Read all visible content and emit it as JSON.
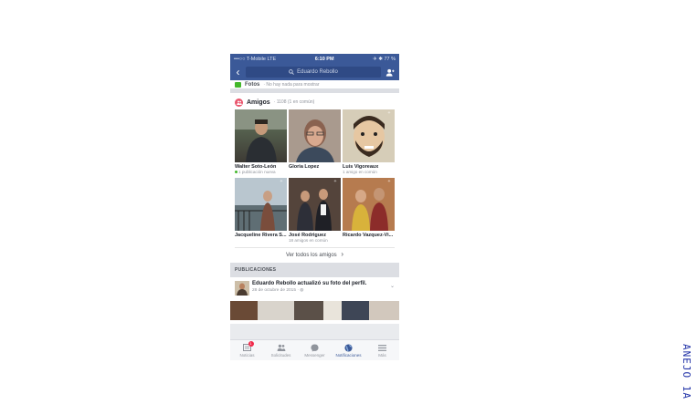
{
  "status_bar": {
    "carrier": "•••○○ T-Mobile  LTE",
    "time": "6:10 PM",
    "battery": "✈ ✱ 77 %"
  },
  "nav": {
    "search_text": "Eduardo Rebollo",
    "back_icon": "chevron-left-icon",
    "friend_icon": "friend-request-icon"
  },
  "fotos": {
    "title": "Fotos",
    "subtitle": "· No hay nada para mostrar"
  },
  "friends": {
    "title": "Amigos",
    "count": "· 1108 (1 en común)",
    "items": [
      {
        "name": "Walter Soto-León",
        "sub": "1 publicación nueva",
        "new_dot": true,
        "add_icon": false
      },
      {
        "name": "Gloria Lopez",
        "sub": "",
        "new_dot": false,
        "add_icon": false
      },
      {
        "name": "Luis Vigoreaux",
        "sub": "1 amigo en común",
        "new_dot": false,
        "add_icon": true
      },
      {
        "name": "Jacqueline Rivera S...",
        "sub": "",
        "new_dot": false,
        "add_icon": true
      },
      {
        "name": "José Rodriguez",
        "sub": "18 amigos en común",
        "new_dot": false,
        "add_icon": true
      },
      {
        "name": "Ricardo Vazquez-Vi...",
        "sub": "",
        "new_dot": false,
        "add_icon": true
      }
    ],
    "see_all": "Ver todos los amigos"
  },
  "publications": {
    "header": "PUBLICACIONES",
    "post_text": "Eduardo Rebollo actualizó su foto del perfil.",
    "post_date": "28 de octubre de 2015 · ◍"
  },
  "tabbar": {
    "tabs": [
      {
        "label": "Noticias",
        "badge": "1"
      },
      {
        "label": "Solicitudes",
        "badge": ""
      },
      {
        "label": "Messenger",
        "badge": ""
      },
      {
        "label": "Notificaciones",
        "badge": ""
      },
      {
        "label": "Más",
        "badge": ""
      }
    ]
  },
  "annotation": "ANEJO 1A",
  "colors": {
    "brand": "#3b5998",
    "badge": "#f02849",
    "friends_icon": "#e9556d"
  }
}
